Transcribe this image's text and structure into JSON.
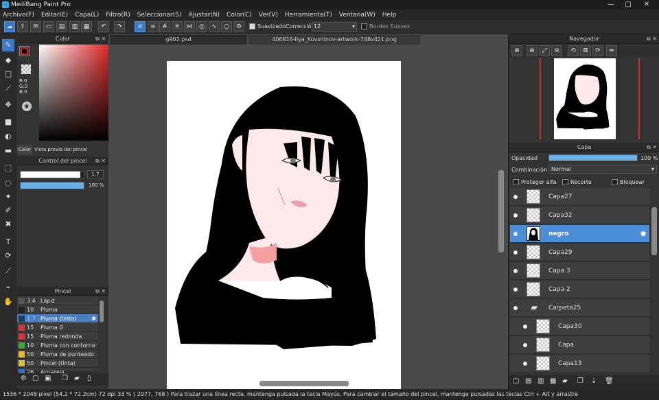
{
  "title": "MediBang Paint Pro",
  "window_controls": {
    "minimize": "—",
    "maximize": "□",
    "close": "✕"
  },
  "menu": [
    "Archivo(F)",
    "Editar(E)",
    "Capa(L)",
    "Filtro(R)",
    "Seleccionar(S)",
    "Ajustar(N)",
    "Color(C)",
    "Ver(V)",
    "Herramienta(T)",
    "Ventana(W)",
    "Help"
  ],
  "toolbar": {
    "suavizado_label": "Suavizado",
    "correccion_label": "Corrección",
    "correccion_value": "12",
    "bordes_label": "Bordes Suaves"
  },
  "color_panel": {
    "title": "Color",
    "r": "R:0",
    "g": "G:0",
    "b": "B:0",
    "tab_color": "Color",
    "tab_preview": "Vista previa del pincel",
    "foreground": "#000000",
    "background": "#ffffff"
  },
  "brush_control": {
    "title": "Control del pincel",
    "size_value": "1.7",
    "opacity_value": "100 %",
    "size_fraction": 0.95,
    "opacity_fraction": 1.0
  },
  "pincel": {
    "title": "Pincel",
    "items": [
      {
        "color": "#555555",
        "size": "3.4",
        "name": "Lápiz"
      },
      {
        "color": "#222222",
        "size": "10",
        "name": "Pluma"
      },
      {
        "color": "#1e3a66",
        "size": "1.7",
        "name": "Pluma (tinta)",
        "selected": true
      },
      {
        "color": "#e03030",
        "size": "15",
        "name": "Pluma G"
      },
      {
        "color": "#e03030",
        "size": "15",
        "name": "Pluma redonda"
      },
      {
        "color": "#30b030",
        "size": "10",
        "name": "Pluma con contorno"
      },
      {
        "color": "#e0c030",
        "size": "50",
        "name": "Pluma de punteado"
      },
      {
        "color": "#e0c030",
        "size": "50",
        "name": "Pincel (tinta)"
      },
      {
        "color": "#3070d0",
        "size": "26",
        "name": "Acuarela"
      }
    ]
  },
  "tabs": [
    "g902.psd",
    "406816-Ilya_Kuvshinov-artwork-748x421.png"
  ],
  "navigator": {
    "title": "Navegador"
  },
  "layers": {
    "title": "Capa",
    "opacity_label": "Opacidad",
    "opacity_value": "100 %",
    "opacity_fraction": 1.0,
    "blend_label": "Combinación",
    "blend_value": "Normal",
    "protect_alpha": "Proteger alfa",
    "clip": "Recorte",
    "lock": "Bloquear",
    "items": [
      {
        "name": "Capa27",
        "indent": 0
      },
      {
        "name": "Capa32",
        "indent": 0
      },
      {
        "name": "negro",
        "indent": 0,
        "selected": true
      },
      {
        "name": "Capa29",
        "indent": 0
      },
      {
        "name": "Capa 3",
        "indent": 0
      },
      {
        "name": "Capa 2",
        "indent": 0
      },
      {
        "name": "Carpeta25",
        "indent": 0,
        "folder": true
      },
      {
        "name": "Capa30",
        "indent": 1
      },
      {
        "name": "Capa",
        "indent": 1
      },
      {
        "name": "Capa13",
        "indent": 1
      }
    ]
  },
  "status": "1536 * 2048 pixel   (54.2 * 72.2cm)   72 dpi   33 %   ( 2077, 768 )   Para trazar una línea recta, mantenga pulsada la tecla Mayús. Para cambiar el tamaño del pincel, mantenga pulsadas las teclas Ctrl + Alt y arrastre"
}
